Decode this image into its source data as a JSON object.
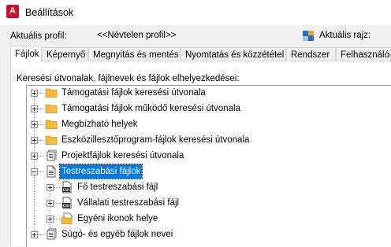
{
  "window": {
    "title": "Beállítások",
    "app_icon_letter": "A"
  },
  "profile": {
    "label": "Aktuális profil:",
    "value": "<<Névtelen profil>>"
  },
  "drawing": {
    "label": "Aktuális rajz:"
  },
  "tabs": [
    {
      "label": "Fájlok",
      "active": true
    },
    {
      "label": "Képernyő"
    },
    {
      "label": "Megnyitás és mentés"
    },
    {
      "label": "Nyomtatás és közzététel"
    },
    {
      "label": "Rendszer"
    },
    {
      "label": "Felhasználói beállít"
    }
  ],
  "panel": {
    "caption": "Keresési útvonalak, fájlnevek és fájlok elhelyezkedései:"
  },
  "tree": [
    {
      "label": "Támogatási fájlok keresési útvonala",
      "icon": "folder-icon"
    },
    {
      "label": "Támogatási fájlok működő keresési útvonala",
      "icon": "folder-icon"
    },
    {
      "label": "Megbízható helyek",
      "icon": "folder-icon"
    },
    {
      "label": "Eszközillesztőprogram-fájlok keresési útvonala",
      "icon": "folder-icon"
    },
    {
      "label": "Projektfájlok keresési útvonala",
      "icon": "document-stack-icon"
    },
    {
      "label": "Testreszabási fájlok",
      "icon": "document-icon",
      "selected": true,
      "children": [
        {
          "label": "Fő testreszabási fájl",
          "icon": "cui-file-icon"
        },
        {
          "label": "Vállalati testreszabási fájl",
          "icon": "cui-file-icon"
        },
        {
          "label": "Egyéni ikonok helye",
          "icon": "folder-icon"
        }
      ]
    },
    {
      "label": "Súgó- és egyéb fájlok nevei",
      "icon": "document-stack-icon"
    }
  ]
}
